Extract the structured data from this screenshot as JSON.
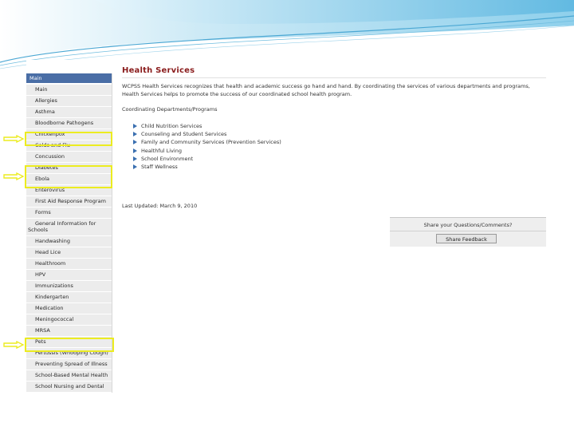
{
  "page": {
    "title": "Health Services",
    "intro": "WCPSS Health Services recognizes that health and academic success go hand and hand. By coordinating the services of various departments and programs, Health Services helps to promote the success of our coordinated school health program.",
    "coordinating_heading": "Coordinating Departments/Programs",
    "coordinating_items": [
      "Child Nutrition Services",
      "Counseling and Student Services",
      "Family and Community Services (Prevention Services)",
      "Healthful Living",
      "School Environment",
      "Staff Wellness"
    ],
    "last_updated": "Last Updated: March 9, 2010"
  },
  "sidebar": {
    "title": "Main",
    "items": [
      "Main",
      "Allergies",
      "Asthma",
      "Bloodborne Pathogens",
      "Chickenpox",
      "Colds and Flu",
      "Concussion",
      "Diabetes",
      "Ebola",
      "Enterovirus",
      "First Aid Response Program",
      "Forms",
      "General Information for Schools",
      "Handwashing",
      "Head Lice",
      "Healthroom",
      "HPV",
      "Immunizations",
      "Kindergarten",
      "Medication",
      "Meningococcal",
      "MRSA",
      "Pets",
      "Pertussis (Whooping Cough)",
      "Preventing Spread of Illness",
      "School-Based Mental Health",
      "School Nursing and Dental"
    ]
  },
  "feedback": {
    "question": "Share your Questions/Comments?",
    "button_label": "Share Feedback"
  },
  "colors": {
    "nav_header": "#4a6ea6",
    "title": "#8a1c1c",
    "highlight": "#ecec20",
    "banner_light": "#9fd6ee",
    "banner_dark": "#3fa6d6"
  }
}
